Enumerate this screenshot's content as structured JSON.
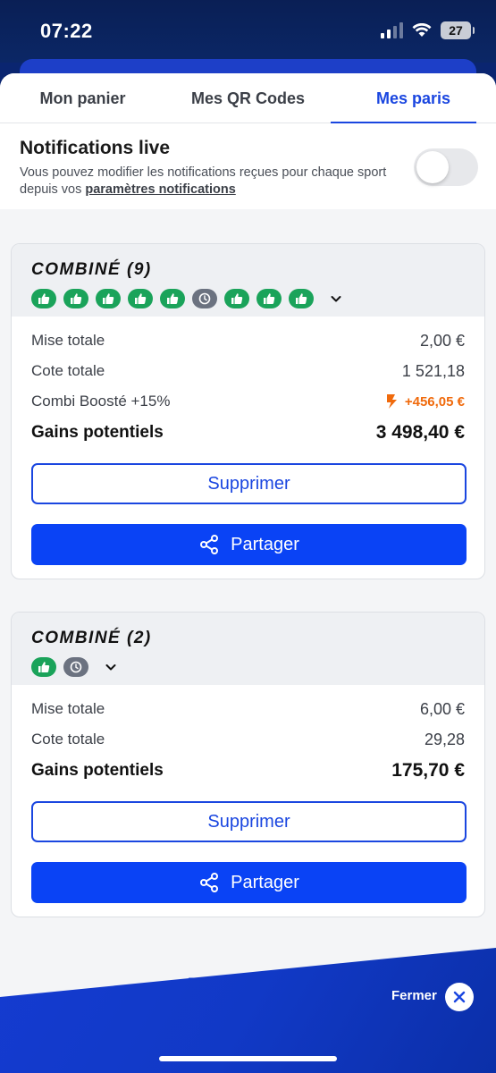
{
  "status": {
    "time": "07:22",
    "battery": "27"
  },
  "tabs": [
    {
      "label": "Mon panier",
      "active": false
    },
    {
      "label": "Mes QR Codes",
      "active": false
    },
    {
      "label": "Mes paris",
      "active": true
    }
  ],
  "notifications": {
    "title": "Notifications live",
    "description": "Vous pouvez modifier les notifications reçues pour chaque sport depuis vos ",
    "link": "paramètres notifications",
    "enabled": false
  },
  "bets": [
    {
      "title": "COMBINÉ (9)",
      "picks": [
        "won",
        "won",
        "won",
        "won",
        "won",
        "pending",
        "won",
        "won",
        "won"
      ],
      "stake_label": "Mise totale",
      "stake": "2,00 €",
      "odds_label": "Cote totale",
      "odds": "1 521,18",
      "boost_label": "Combi Boosté +15%",
      "boost": "+456,05 €",
      "gains_label": "Gains potentiels",
      "gains": "3 498,40 €",
      "delete_label": "Supprimer",
      "share_label": "Partager"
    },
    {
      "title": "COMBINÉ (2)",
      "picks": [
        "won",
        "pending"
      ],
      "stake_label": "Mise totale",
      "stake": "6,00 €",
      "odds_label": "Cote totale",
      "odds": "29,28",
      "gains_label": "Gains potentiels",
      "gains": "175,70 €",
      "delete_label": "Supprimer",
      "share_label": "Partager"
    }
  ],
  "footer": {
    "partial_link": "P",
    "close_label": "Fermer"
  },
  "colors": {
    "accent": "#1a46e0",
    "won": "#1aa35a",
    "pending": "#6b7280",
    "boost": "#f06a0c"
  },
  "icons": {
    "won_pick": "thumbs-up-icon",
    "pending_pick": "clock-icon",
    "share": "share-icon",
    "boost": "lightning-icon",
    "close": "close-icon"
  }
}
